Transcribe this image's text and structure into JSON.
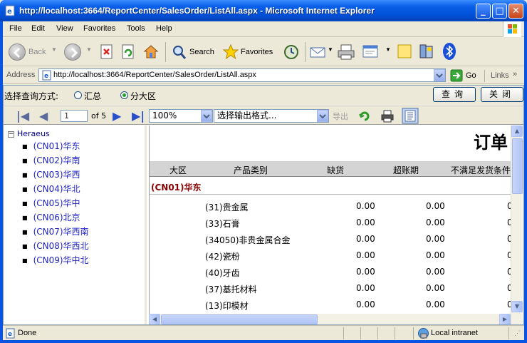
{
  "window": {
    "title": "http://localhost:3664/ReportCenter/SalesOrder/ListAll.aspx - Microsoft Internet Explorer",
    "min_glyph": "_",
    "max_glyph": "□",
    "close_glyph": "✕"
  },
  "menu": [
    "File",
    "Edit",
    "View",
    "Favorites",
    "Tools",
    "Help"
  ],
  "toolbar": {
    "back_label": "Back",
    "search_label": "Search",
    "favorites_label": "Favorites"
  },
  "address": {
    "label": "Address",
    "url": "http://localhost:3664/ReportCenter/SalesOrder/ListAll.aspx",
    "go_label": "Go",
    "links_label": "Links"
  },
  "query": {
    "label": "选择查询方式:",
    "option_summary": "汇总",
    "option_region": "分大区",
    "selected": "分大区",
    "query_button": "查询",
    "close_button": "关闭"
  },
  "report_toolbar": {
    "page_current": "1",
    "page_total_text": "of 5",
    "zoom": "100%",
    "export_format_placeholder": "选择输出格式...",
    "export_label": "导出"
  },
  "tree": {
    "root": "Heraeus",
    "items": [
      "(CN01)华东",
      "(CN02)华南",
      "(CN03)华西",
      "(CN04)华北",
      "(CN05)华中",
      "(CN06)北京",
      "(CN07)华西南",
      "(CN08)华西北",
      "(CN09)华中北"
    ]
  },
  "report": {
    "title": "订单",
    "columns": [
      "大区",
      "产品类别",
      "缺货",
      "超账期",
      "不满足发货条件"
    ],
    "group": "(CN01)华东",
    "rows": [
      {
        "category": "(31)贵金属",
        "shortage": "0.00",
        "overdue": "0.00",
        "other": "0"
      },
      {
        "category": "(33)石膏",
        "shortage": "0.00",
        "overdue": "0.00",
        "other": "0"
      },
      {
        "category": "(34050)非贵金属合金",
        "shortage": "0.00",
        "overdue": "0.00",
        "other": "0"
      },
      {
        "category": "(42)瓷粉",
        "shortage": "0.00",
        "overdue": "0.00",
        "other": "0"
      },
      {
        "category": "(40)牙齿",
        "shortage": "0.00",
        "overdue": "0.00",
        "other": "0"
      },
      {
        "category": "(37)基托材料",
        "shortage": "0.00",
        "overdue": "0.00",
        "other": "0"
      },
      {
        "category": "(13)印模材",
        "shortage": "0.00",
        "overdue": "0.00",
        "other": "0"
      }
    ]
  },
  "status": {
    "left": "Done",
    "zone": "Local intranet"
  },
  "colors": {
    "titlebar": "#0a5fe8",
    "tree_link": "#1f22c6",
    "group_header": "#8b0000"
  }
}
